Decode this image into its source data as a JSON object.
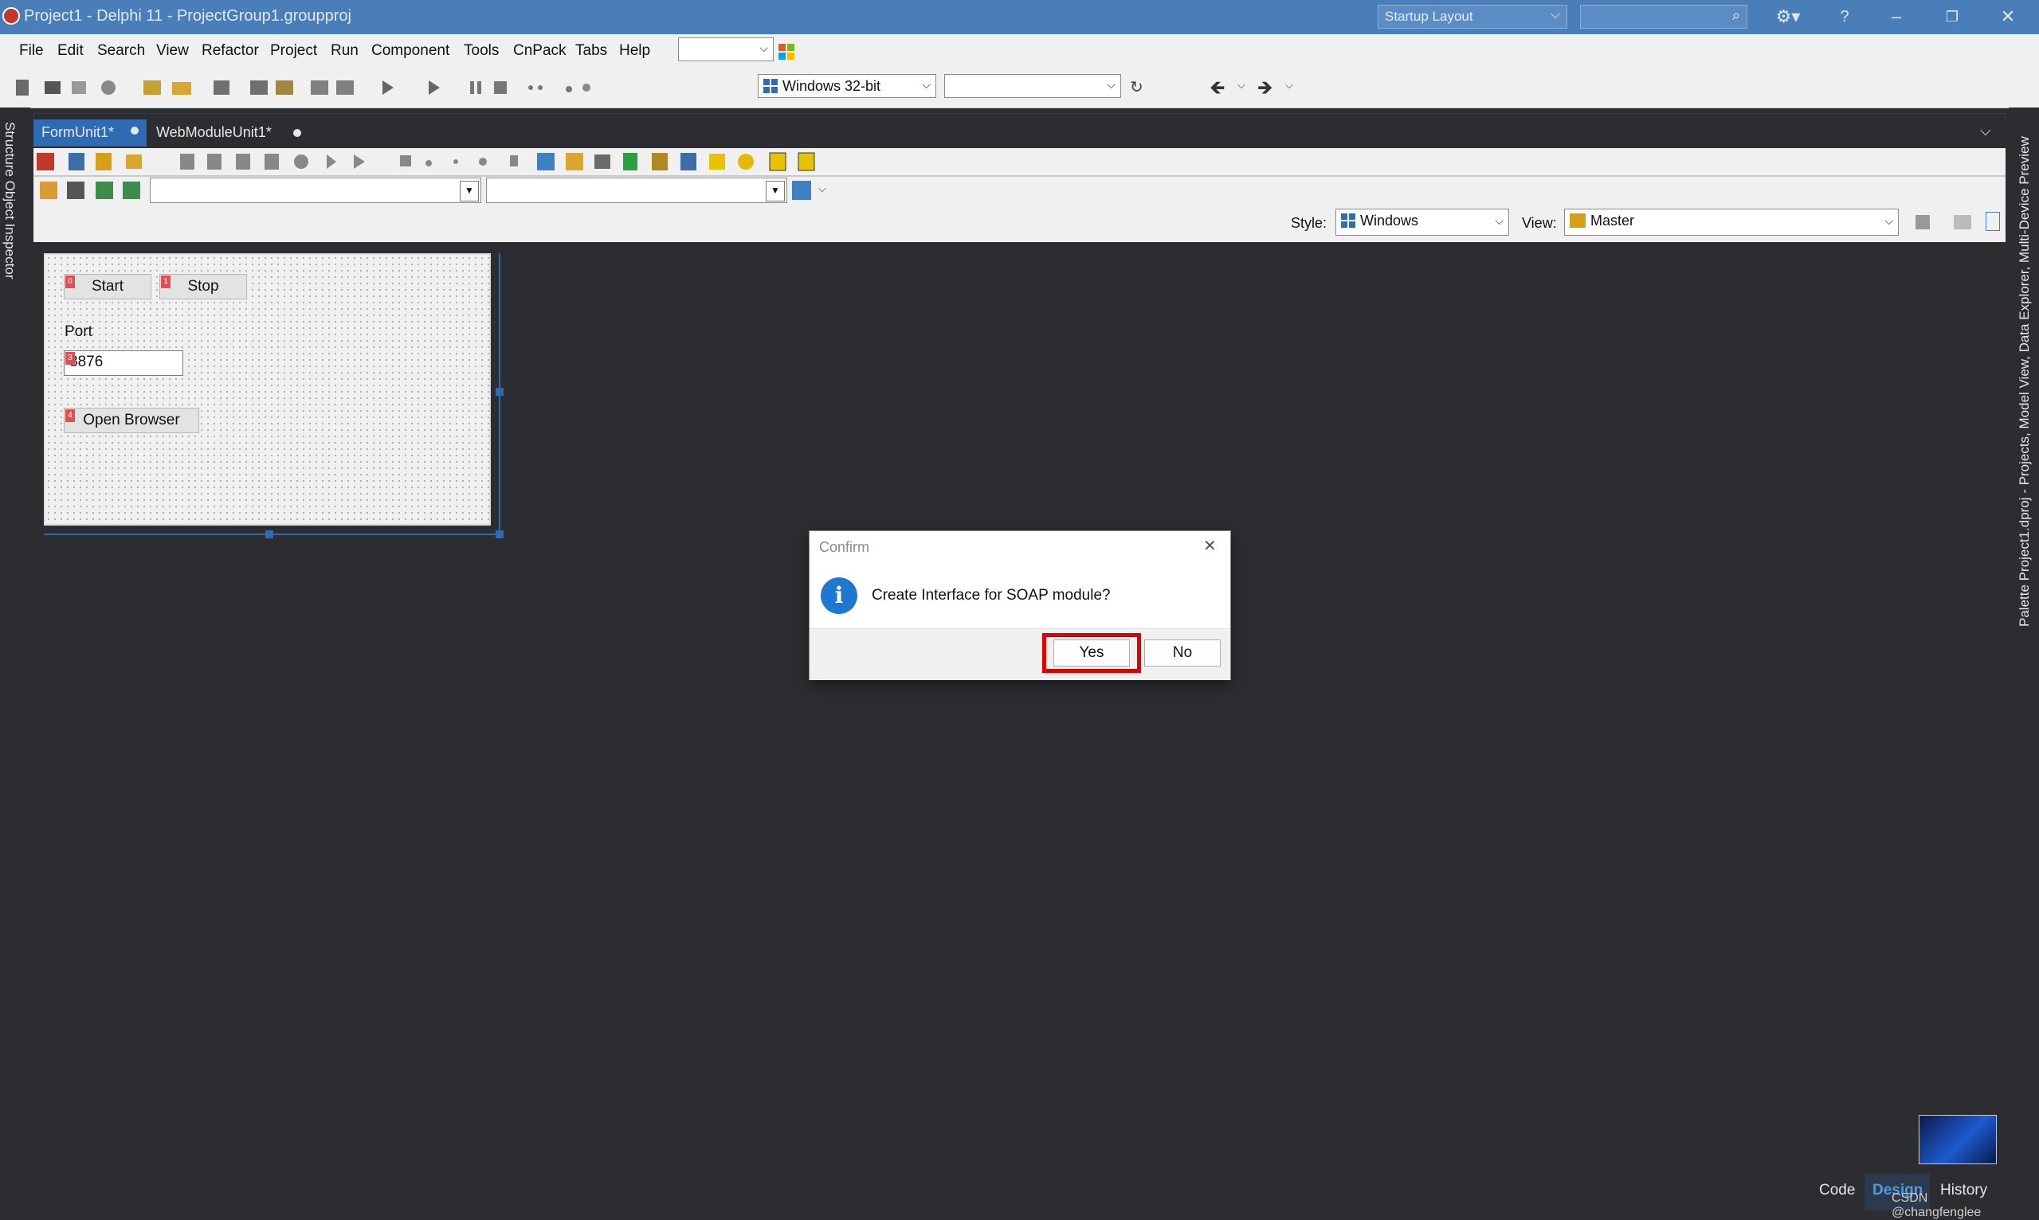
{
  "window": {
    "title": "Project1 - Delphi 11 - ProjectGroup1.groupproj",
    "layout_combo": "Startup Layout",
    "search_placeholder": "",
    "help_label": "?"
  },
  "menu": [
    "File",
    "Edit",
    "Search",
    "View",
    "Refactor",
    "Project",
    "Run",
    "Component",
    "Tools",
    "CnPack",
    "Tabs",
    "Help"
  ],
  "toolbar": {
    "platform": "Windows 32-bit",
    "config": ""
  },
  "left_rail": {
    "label": "Structure  Object Inspector"
  },
  "right_rail": {
    "label": "Palette  Project1.dproj - Projects, Model View, Data Explorer, Multi-Device Preview"
  },
  "doc_tabs": [
    {
      "label": "FormUnit1*"
    },
    {
      "label": "WebModuleUnit1*"
    }
  ],
  "designer": {
    "style_label": "Style:",
    "style_value": "Windows",
    "view_label": "View:",
    "view_value": "Master"
  },
  "form": {
    "start_button": "Start",
    "stop_button": "Stop",
    "port_label": "Port",
    "port_value": "8876",
    "open_browser_button": "Open Browser",
    "tag0": "0",
    "tag1": "1",
    "tag3": "3",
    "tag4": "4"
  },
  "dialog": {
    "title": "Confirm",
    "message": "Create Interface for SOAP module?",
    "yes": "Yes",
    "no": "No",
    "close": "✕"
  },
  "bottom_tabs": [
    "Code",
    "Design",
    "History"
  ],
  "watermark": "CSDN @changfenglee",
  "colors": {
    "title_bar": "#4a7eb8",
    "editor_bg": "#2b2d31",
    "active_tab": "#2d6bb3",
    "highlight": "#e00000",
    "info_icon": "#1e78d2"
  }
}
